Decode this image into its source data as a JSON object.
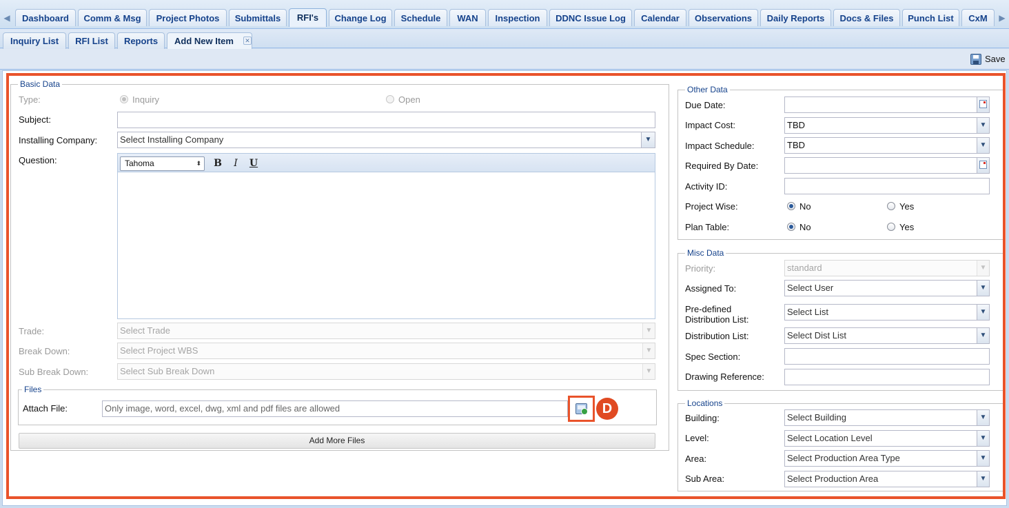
{
  "main_tabs": [
    "Dashboard",
    "Comm & Msg",
    "Project Photos",
    "Submittals",
    "RFI's",
    "Change Log",
    "Schedule",
    "WAN",
    "Inspection",
    "DDNC Issue Log",
    "Calendar",
    "Observations",
    "Daily Reports",
    "Docs & Files",
    "Punch List",
    "CxM"
  ],
  "sub_tabs": [
    "Inquiry List",
    "RFI List",
    "Reports",
    "Add New Item"
  ],
  "toolbar": {
    "save_label": "Save"
  },
  "basic_data": {
    "legend": "Basic Data",
    "type_label": "Type:",
    "type_options": [
      "Inquiry",
      "Open"
    ],
    "subject_label": "Subject:",
    "subject_value": "",
    "installing_company_label": "Installing Company:",
    "installing_company_value": "Select Installing Company",
    "question_label": "Question:",
    "editor_font": "Tahoma",
    "trade_label": "Trade:",
    "trade_value": "Select Trade",
    "breakdown_label": "Break Down:",
    "breakdown_value": "Select Project WBS",
    "sub_breakdown_label": "Sub Break Down:",
    "sub_breakdown_value": "Select Sub Break Down"
  },
  "files": {
    "legend": "Files",
    "attach_label": "Attach File:",
    "attach_placeholder": "Only image, word, excel, dwg, xml and pdf files are allowed",
    "add_more_label": "Add More Files",
    "marker": "D"
  },
  "other_data": {
    "legend": "Other Data",
    "due_date_label": "Due Date:",
    "impact_cost_label": "Impact Cost:",
    "impact_cost_value": "TBD",
    "impact_schedule_label": "Impact Schedule:",
    "impact_schedule_value": "TBD",
    "required_by_label": "Required By Date:",
    "activity_id_label": "Activity ID:",
    "project_wise_label": "Project Wise:",
    "plan_table_label": "Plan Table:",
    "no_label": "No",
    "yes_label": "Yes"
  },
  "misc_data": {
    "legend": "Misc Data",
    "priority_label": "Priority:",
    "priority_value": "standard",
    "assigned_to_label": "Assigned To:",
    "assigned_to_value": "Select User",
    "predef_label_1": "Pre-defined",
    "predef_label_2": "Distribution List:",
    "predef_value": "Select List",
    "dist_list_label": "Distribution List:",
    "dist_list_value": "Select Dist List",
    "spec_section_label": "Spec Section:",
    "drawing_ref_label": "Drawing Reference:"
  },
  "locations": {
    "legend": "Locations",
    "building_label": "Building:",
    "building_value": "Select Building",
    "level_label": "Level:",
    "level_value": "Select Location Level",
    "area_label": "Area:",
    "area_value": "Select Production Area Type",
    "sub_area_label": "Sub Area:",
    "sub_area_value": "Select Production Area"
  }
}
